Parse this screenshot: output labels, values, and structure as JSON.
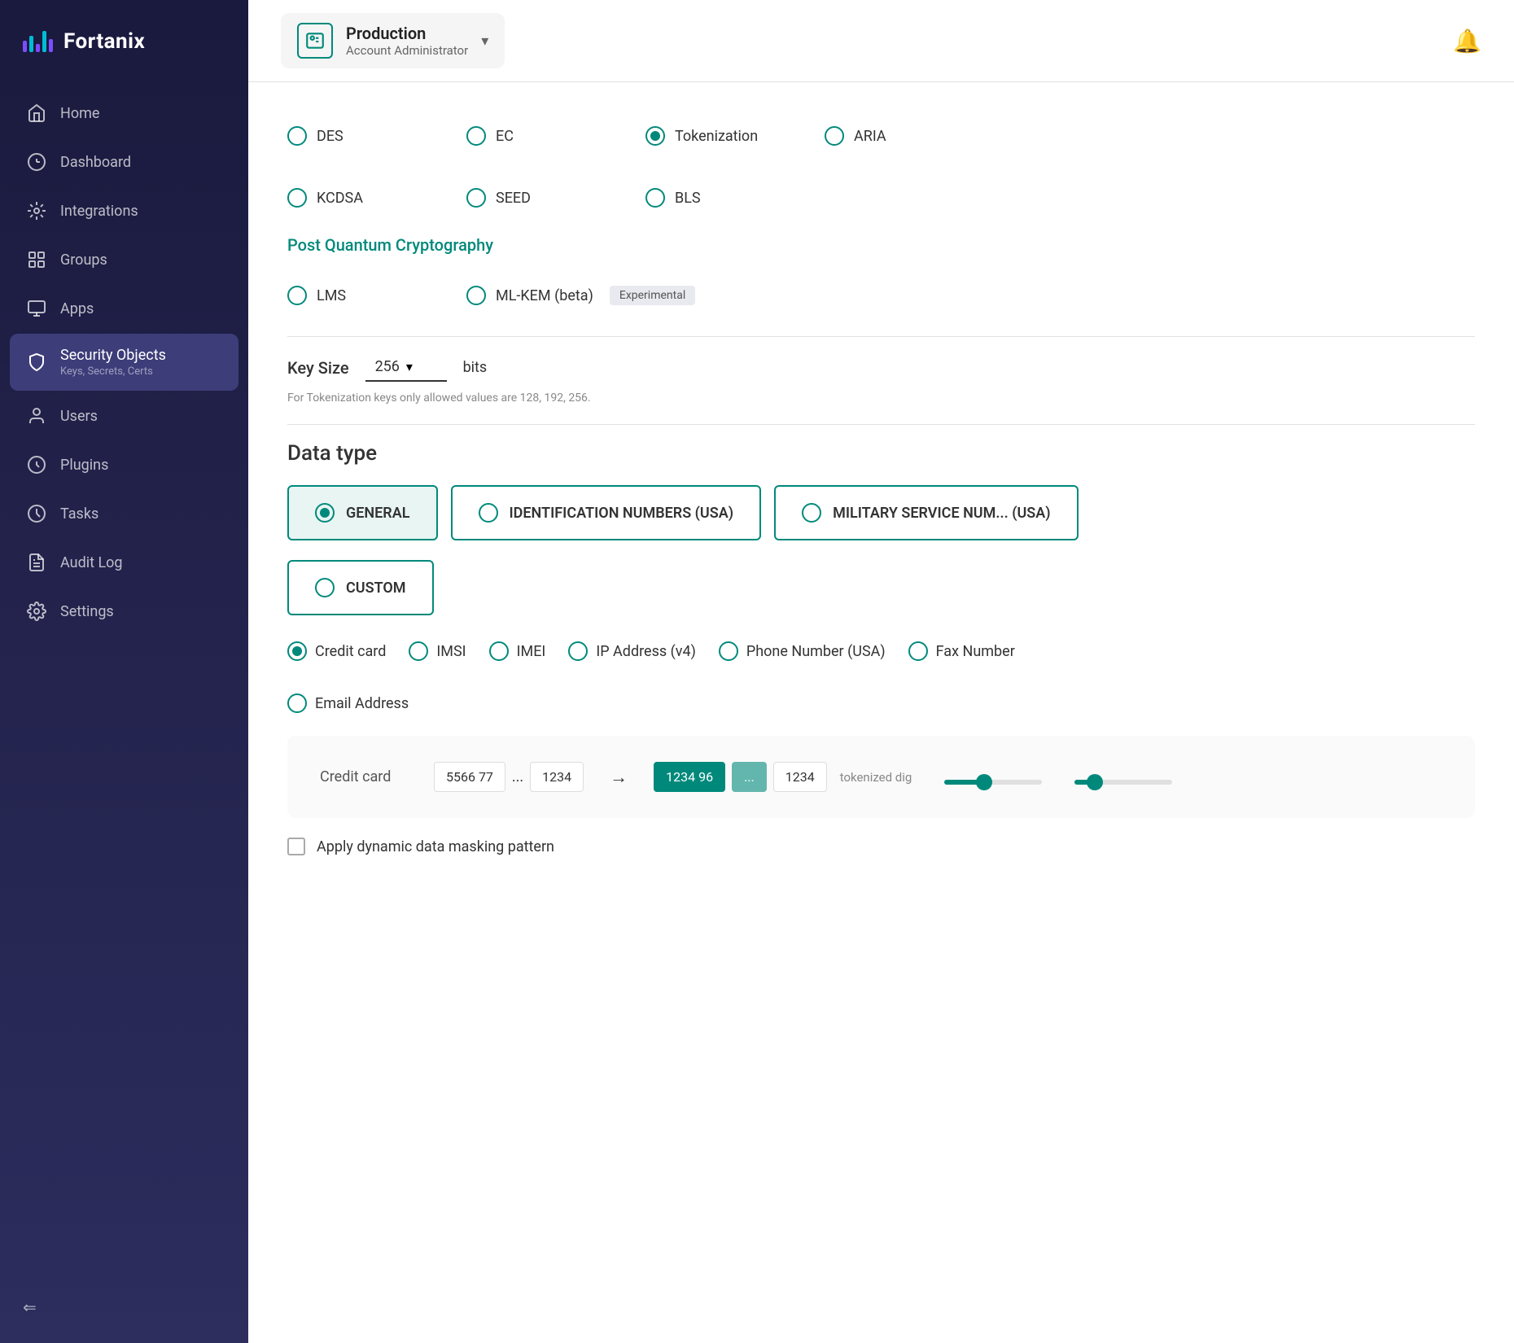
{
  "sidebar": {
    "logo_text": "Fortanix",
    "items": [
      {
        "id": "home",
        "label": "Home",
        "icon": "home"
      },
      {
        "id": "dashboard",
        "label": "Dashboard",
        "icon": "dashboard"
      },
      {
        "id": "integrations",
        "label": "Integrations",
        "icon": "integrations"
      },
      {
        "id": "groups",
        "label": "Groups",
        "icon": "groups"
      },
      {
        "id": "apps",
        "label": "Apps",
        "icon": "apps"
      },
      {
        "id": "security-objects",
        "label": "Security Objects",
        "sub": "Keys, Secrets, Certs",
        "icon": "security",
        "active": true
      },
      {
        "id": "users",
        "label": "Users",
        "icon": "users"
      },
      {
        "id": "plugins",
        "label": "Plugins",
        "icon": "plugins"
      },
      {
        "id": "tasks",
        "label": "Tasks",
        "icon": "tasks"
      },
      {
        "id": "audit-log",
        "label": "Audit Log",
        "icon": "audit"
      },
      {
        "id": "settings",
        "label": "Settings",
        "icon": "settings"
      }
    ],
    "collapse_label": "Collapse"
  },
  "header": {
    "account_name": "Production",
    "account_role": "Account Administrator",
    "bell_title": "Notifications"
  },
  "algorithm_section": {
    "options_row1": [
      {
        "id": "des",
        "label": "DES",
        "checked": false
      },
      {
        "id": "ec",
        "label": "EC",
        "checked": false
      },
      {
        "id": "tokenization",
        "label": "Tokenization",
        "checked": true
      },
      {
        "id": "aria",
        "label": "ARIA",
        "checked": false
      }
    ],
    "options_row2": [
      {
        "id": "kcdsa",
        "label": "KCDSA",
        "checked": false
      },
      {
        "id": "seed",
        "label": "SEED",
        "checked": false
      },
      {
        "id": "bls",
        "label": "BLS",
        "checked": false
      }
    ],
    "pqc_title": "Post Quantum Cryptography",
    "pqc_options": [
      {
        "id": "lms",
        "label": "LMS",
        "checked": false
      },
      {
        "id": "ml-kem",
        "label": "ML-KEM (beta)",
        "badge": "Experimental",
        "checked": false
      }
    ]
  },
  "key_size": {
    "label": "Key Size",
    "value": "256",
    "unit": "bits",
    "hint": "For Tokenization keys only allowed values are 128, 192, 256."
  },
  "data_type": {
    "title": "Data type",
    "cards": [
      {
        "id": "general",
        "label": "GENERAL",
        "checked": true,
        "active": true
      },
      {
        "id": "identification-numbers",
        "label": "IDENTIFICATION NUMBERS (USA)",
        "checked": false
      },
      {
        "id": "military-service",
        "label": "MILITARY SERVICE NUM... (USA)",
        "checked": false
      }
    ],
    "custom_card": {
      "id": "custom",
      "label": "CUSTOM",
      "checked": false
    },
    "sub_options": [
      {
        "id": "credit-card",
        "label": "Credit card",
        "checked": true
      },
      {
        "id": "imsi",
        "label": "IMSI",
        "checked": false
      },
      {
        "id": "imei",
        "label": "IMEI",
        "checked": false
      },
      {
        "id": "ip-address",
        "label": "IP Address (v4)",
        "checked": false
      },
      {
        "id": "phone-number",
        "label": "Phone Number (USA)",
        "checked": false
      },
      {
        "id": "fax-number",
        "label": "Fax Number",
        "checked": false
      }
    ],
    "sub_options_row2": [
      {
        "id": "email-address",
        "label": "Email Address",
        "checked": false
      }
    ]
  },
  "credit_card_preview": {
    "label": "Credit card",
    "seg1": "5566 77",
    "seg2": "...",
    "seg3": "1234",
    "arrow": "→",
    "tok_seg1": "1234 96",
    "tok_seg2": "...",
    "tok_seg3": "1234",
    "suffix": "tokenized dig"
  },
  "masking": {
    "checkbox_checked": false,
    "label": "Apply dynamic data masking pattern"
  }
}
